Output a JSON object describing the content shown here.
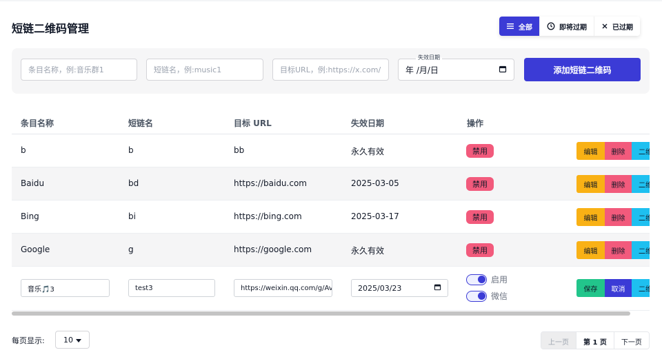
{
  "page": {
    "title": "短链二维码管理"
  },
  "filters": [
    {
      "label": "全部",
      "icon": "list-icon",
      "active": true
    },
    {
      "label": "即将过期",
      "icon": "clock-icon",
      "active": false
    },
    {
      "label": "已过期",
      "icon": "close-icon",
      "active": false
    }
  ],
  "form": {
    "name_placeholder": "条目名称，例:音乐群1",
    "short_placeholder": "短链名，例:music1",
    "url_placeholder": "目标URL，例:https://x.com/",
    "expire_label": "失效日期",
    "expire_value": "年 /月/日",
    "add_button": "添加短链二维码"
  },
  "table": {
    "columns": [
      "条目名称",
      "短链名",
      "目标 URL",
      "失效日期",
      "操作"
    ],
    "rows": [
      {
        "name": "b",
        "short": "b",
        "url": "bb",
        "expire": "永久有效",
        "status": "禁用"
      },
      {
        "name": "Baidu",
        "short": "bd",
        "url": "https://baidu.com",
        "expire": "2025-03-05",
        "status": "禁用"
      },
      {
        "name": "Bing",
        "short": "bi",
        "url": "https://bing.com",
        "expire": "2025-03-17",
        "status": "禁用"
      },
      {
        "name": "Google",
        "short": "g",
        "url": "https://google.com",
        "expire": "永久有效",
        "status": "禁用"
      }
    ],
    "actions": {
      "edit": "编辑",
      "delete": "删除",
      "qr": "二维"
    },
    "edit_row": {
      "name": "音乐🎵3",
      "short": "test3",
      "url": "https://weixin.qq.com/g/Av",
      "expire": "2025/03/23",
      "toggle_enable": "启用",
      "toggle_wechat": "微信",
      "save": "保存",
      "cancel": "取消",
      "qr": "二维"
    }
  },
  "pagination": {
    "per_page_label": "每页显示:",
    "per_page_value": "10",
    "prev": "上一页",
    "current": "第 1 页",
    "next": "下一页"
  },
  "colors": {
    "primary": "#3b3bd6",
    "edit": "#f9b115",
    "danger": "#f25a7c",
    "info": "#1ec0f0",
    "success": "#22c58b"
  }
}
